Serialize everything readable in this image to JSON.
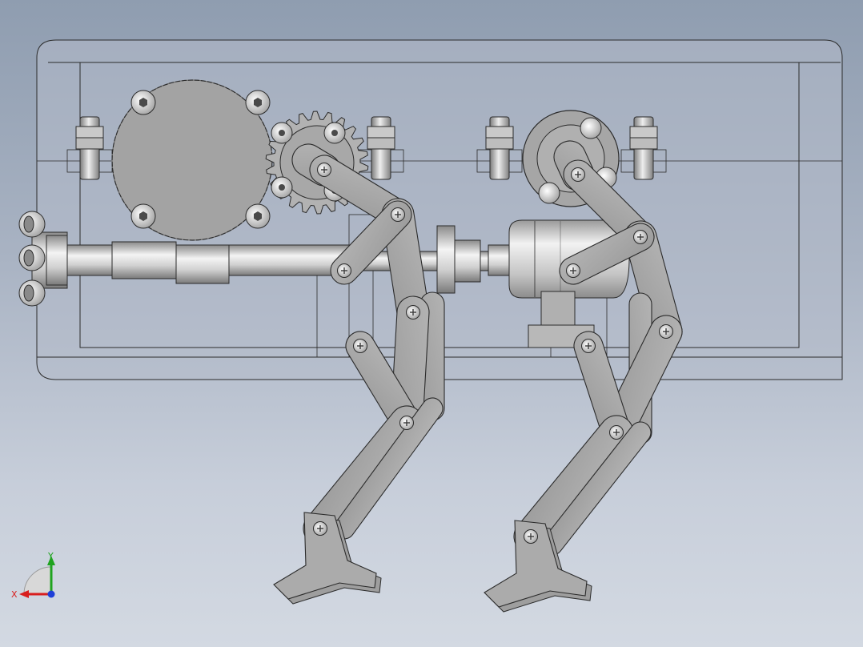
{
  "viewport": {
    "background_top": "#8f9db0",
    "background_bottom": "#d3d9e2"
  },
  "model": {
    "part_fill": "#a5a5a5",
    "part_stroke": "#2b2b2b",
    "housing_fill": "#b4bccb",
    "shaft_fill": "#d8d8d8"
  },
  "triad": {
    "x_label": "X",
    "y_label": "Y",
    "x_color": "#d81e1e",
    "y_color": "#1fa31f",
    "z_color": "#1e3fd8"
  }
}
